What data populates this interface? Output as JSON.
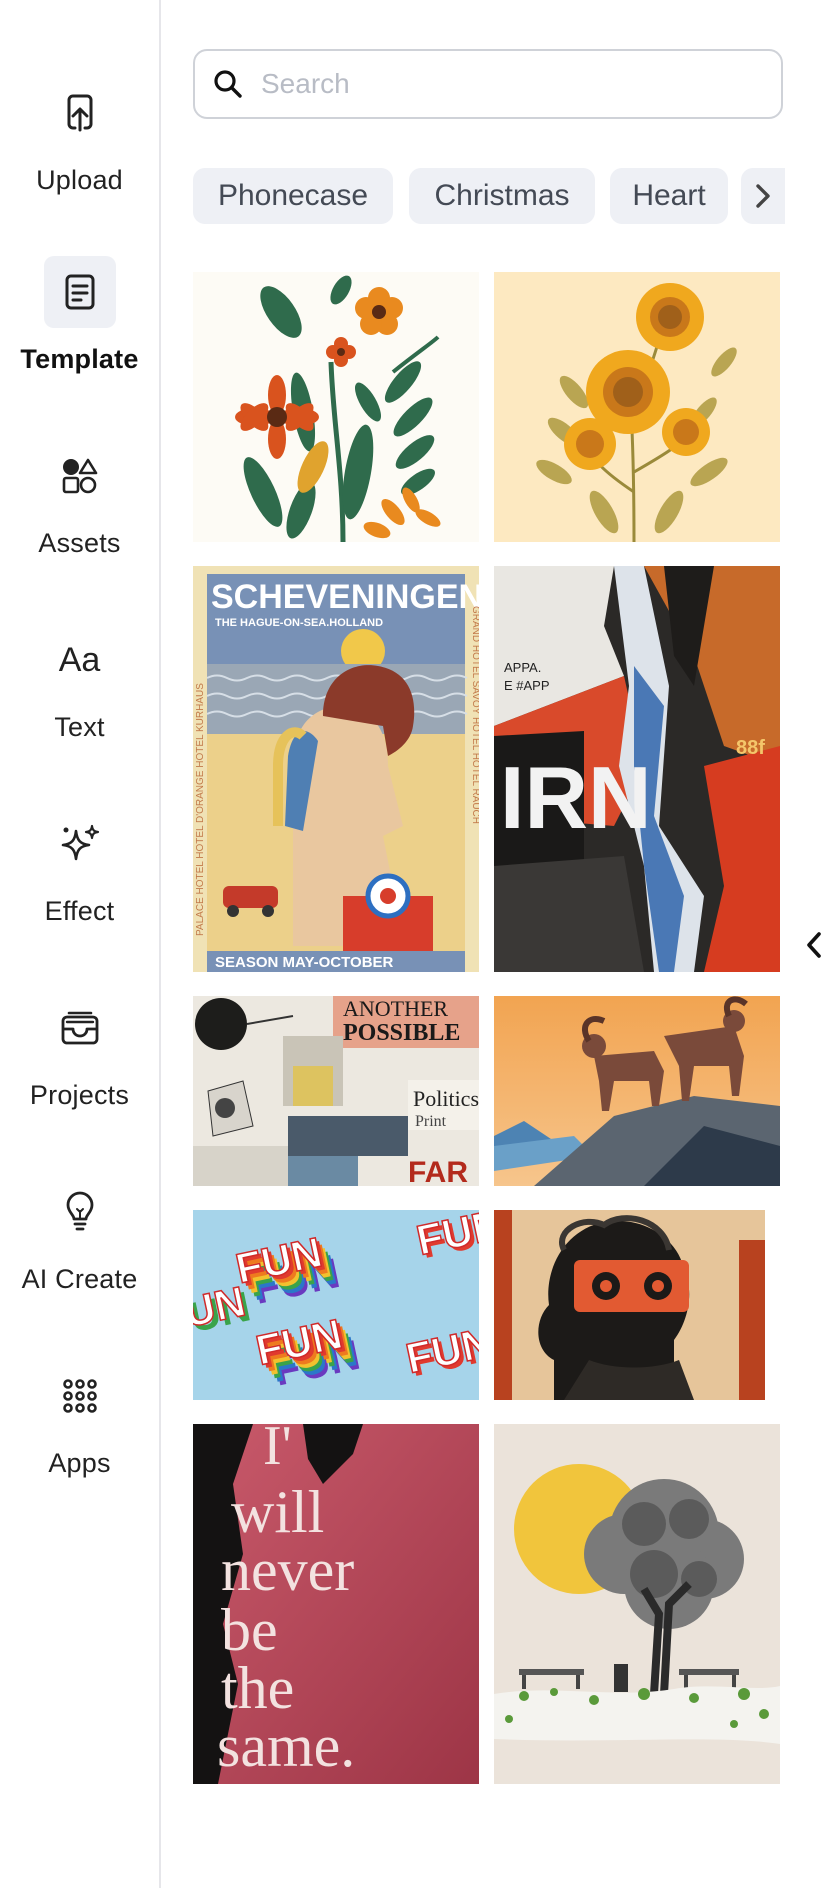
{
  "sidebar": {
    "items": [
      {
        "label": "Upload",
        "icon": "upload-icon"
      },
      {
        "label": "Template",
        "icon": "template-icon",
        "active": true
      },
      {
        "label": "Assets",
        "icon": "shapes-icon"
      },
      {
        "label": "Text",
        "icon": "text-icon",
        "glyph": "Aa"
      },
      {
        "label": "Effect",
        "icon": "sparkle-icon"
      },
      {
        "label": "Projects",
        "icon": "inbox-icon"
      },
      {
        "label": "AI Create",
        "icon": "lightbulb-icon"
      },
      {
        "label": "Apps",
        "icon": "grid-dots-icon"
      }
    ]
  },
  "search": {
    "placeholder": "Search",
    "value": ""
  },
  "tags": [
    "Phonecase",
    "Christmas",
    "Heart"
  ],
  "templates": {
    "items": [
      {
        "name": "flowers-folk-art",
        "text": []
      },
      {
        "name": "sunflowers",
        "text": []
      },
      {
        "name": "scheveningen-poster",
        "text": [
          "SCHEVENINGEN",
          "THE HAGUE-ON-SEA.HOLLAND",
          "SEASON MAY-OCTOBER",
          "PALACE HOTEL HOTEL D'ORANGE HOTEL KURHAUS",
          "GRAND HOTEL SAVOY HOTEL HOTEL RAUCH"
        ]
      },
      {
        "name": "torn-poster-collage",
        "text": [
          "APPA.",
          "E #APP",
          "IRN",
          "88f"
        ]
      },
      {
        "name": "newspaper-collage",
        "text": [
          "ANOTHER",
          "POSSIBLE",
          "Politics",
          "Print",
          "FAR"
        ]
      },
      {
        "name": "rams-mountain",
        "text": []
      },
      {
        "name": "fun-rainbow-pattern",
        "text": [
          "FUN",
          "FUN",
          "FUN",
          "FUN",
          "FUN"
        ]
      },
      {
        "name": "cassette-head-collage",
        "text": []
      },
      {
        "name": "will-never-be-the-same",
        "text": [
          "I'",
          "will",
          "never",
          "be",
          "the",
          "same."
        ]
      },
      {
        "name": "tree-sun-collage",
        "text": []
      }
    ]
  },
  "colors": {
    "accent_bg": "#eef0f5",
    "border": "#cfd2d8"
  }
}
